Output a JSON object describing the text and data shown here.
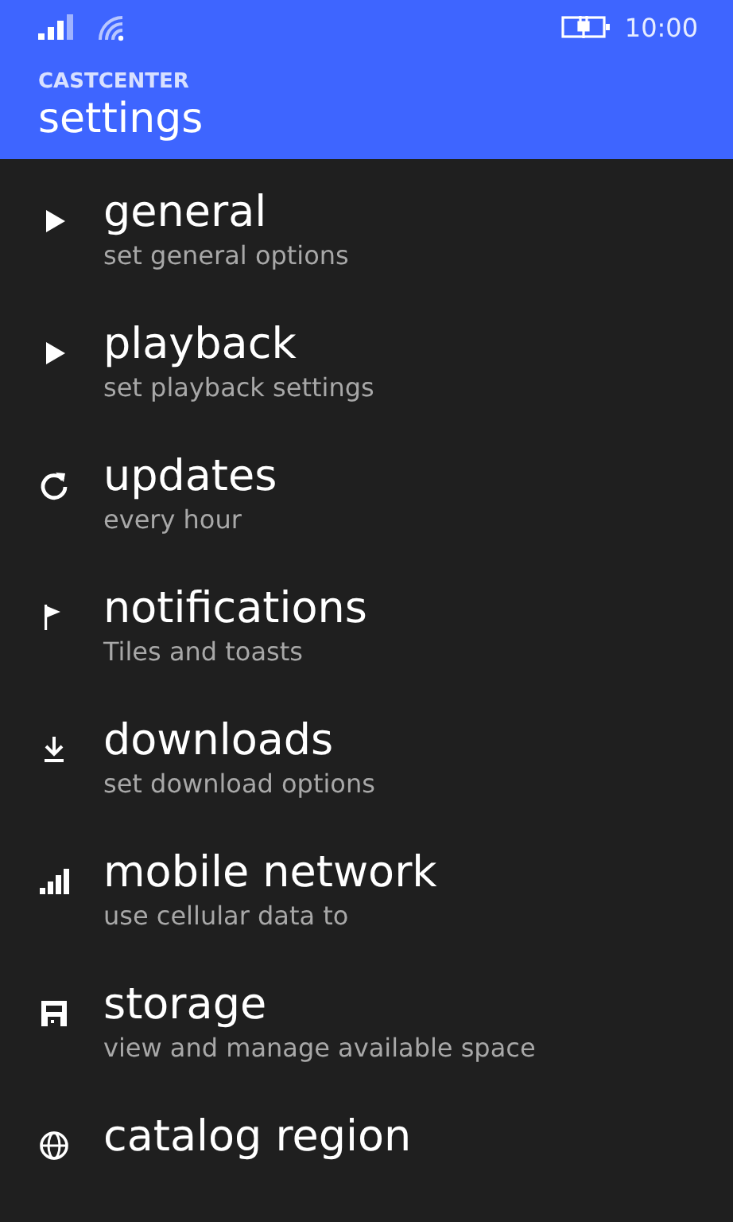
{
  "status_bar": {
    "time": "10:00"
  },
  "header": {
    "app_name": "CASTCENTER",
    "title": "settings"
  },
  "items": [
    {
      "title": "general",
      "subtitle": "set general options"
    },
    {
      "title": "playback",
      "subtitle": "set playback settings"
    },
    {
      "title": "updates",
      "subtitle": "every hour"
    },
    {
      "title": "notifications",
      "subtitle": "Tiles and toasts"
    },
    {
      "title": "downloads",
      "subtitle": "set download options"
    },
    {
      "title": "mobile network",
      "subtitle": "use cellular data to"
    },
    {
      "title": "storage",
      "subtitle": "view and manage available space"
    },
    {
      "title": "catalog region"
    }
  ]
}
